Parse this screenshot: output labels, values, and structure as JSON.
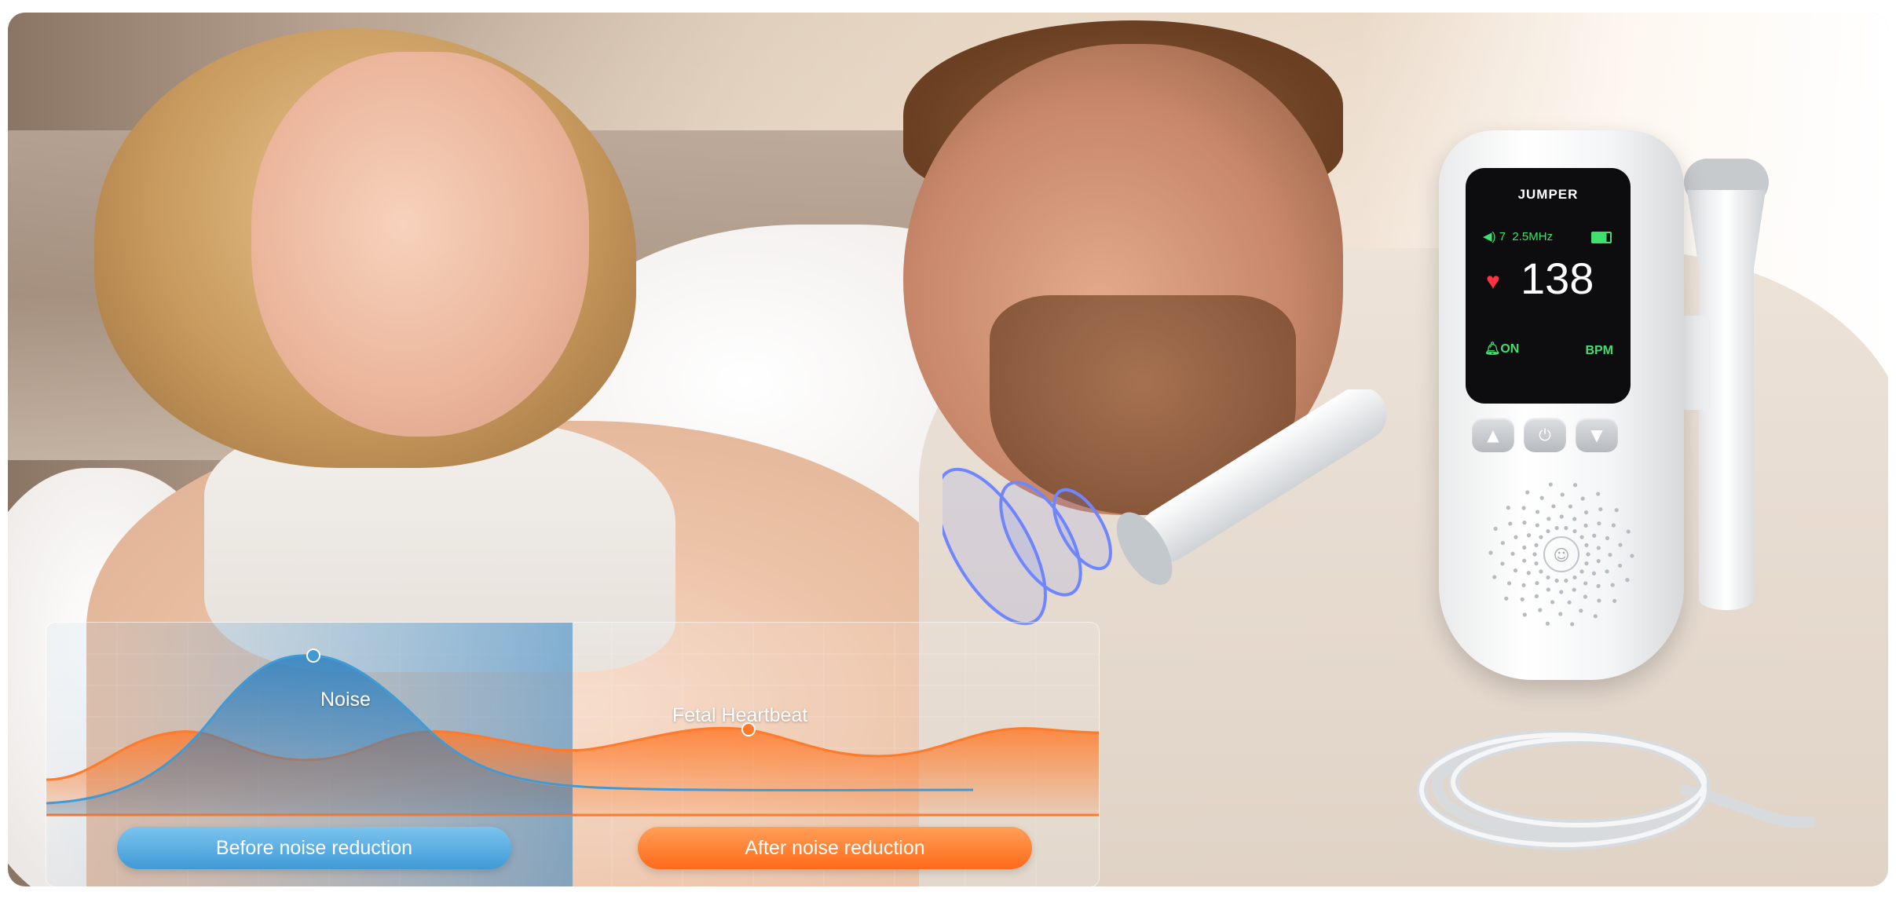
{
  "chart": {
    "noise_label": "Noise",
    "fetal_label": "Fetal Heartbeat",
    "before_label": "Before noise reduction",
    "after_label": "After noise reduction",
    "colors": {
      "noise": "#3f9ad6",
      "fetal": "#ff6a1a"
    }
  },
  "device": {
    "brand": "JUMPER",
    "volume_icon": "speaker-icon",
    "volume_level": "7",
    "frequency": "2.5MHz",
    "battery_icon": "battery-icon",
    "heart_icon": "heart-icon",
    "heart_rate": "138",
    "alarm_icon": "bell-icon",
    "alarm_state": "ON",
    "unit": "BPM",
    "buttons": {
      "up": "▲",
      "power": "⏻",
      "down": "▼"
    }
  }
}
